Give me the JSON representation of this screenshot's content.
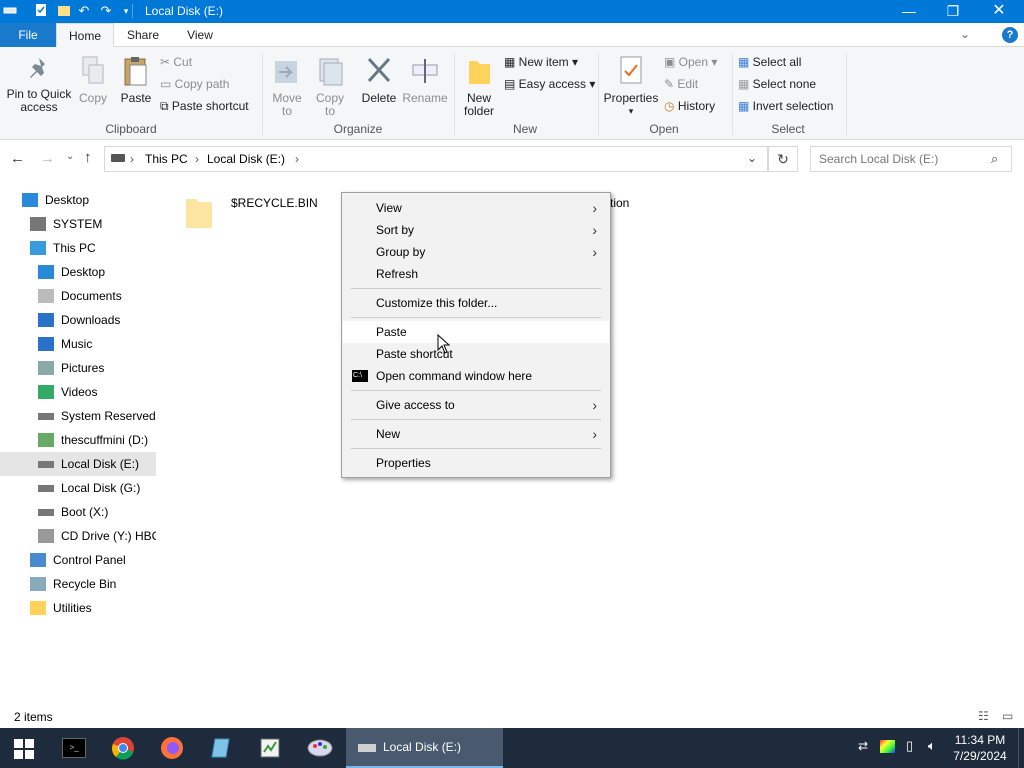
{
  "window": {
    "title": "Local Disk (E:)"
  },
  "ribbon_tabs": {
    "file": "File",
    "home": "Home",
    "share": "Share",
    "view": "View"
  },
  "ribbon": {
    "clipboard": {
      "pin": "Pin to Quick access",
      "copy": "Copy",
      "paste": "Paste",
      "cut": "Cut",
      "copy_path": "Copy path",
      "paste_shortcut": "Paste shortcut",
      "group": "Clipboard"
    },
    "organize": {
      "move_to": "Move to",
      "copy_to": "Copy to",
      "delete": "Delete",
      "rename": "Rename",
      "group": "Organize"
    },
    "new": {
      "new_folder": "New folder",
      "new_item": "New item",
      "easy_access": "Easy access",
      "group": "New"
    },
    "open": {
      "properties": "Properties",
      "open": "Open",
      "edit": "Edit",
      "history": "History",
      "group": "Open"
    },
    "select": {
      "select_all": "Select all",
      "select_none": "Select none",
      "invert": "Invert selection",
      "group": "Select"
    }
  },
  "address": {
    "crumbs": [
      "This PC",
      "Local Disk (E:)"
    ],
    "search_placeholder": "Search Local Disk (E:)"
  },
  "nav": {
    "items": [
      {
        "label": "Desktop",
        "icon": "desktop-icon"
      },
      {
        "label": "SYSTEM",
        "icon": "user-icon"
      },
      {
        "label": "This PC",
        "icon": "computer-icon"
      },
      {
        "label": "Desktop",
        "icon": "desktop-icon"
      },
      {
        "label": "Documents",
        "icon": "documents-icon"
      },
      {
        "label": "Downloads",
        "icon": "downloads-icon"
      },
      {
        "label": "Music",
        "icon": "music-icon"
      },
      {
        "label": "Pictures",
        "icon": "pictures-icon"
      },
      {
        "label": "Videos",
        "icon": "videos-icon"
      },
      {
        "label": "System Reserved (",
        "icon": "drive-icon"
      },
      {
        "label": "thescuffmini (D:)",
        "icon": "usb-drive-icon"
      },
      {
        "label": "Local Disk (E:)",
        "icon": "drive-icon"
      },
      {
        "label": "Local Disk (G:)",
        "icon": "drive-icon"
      },
      {
        "label": "Boot (X:)",
        "icon": "drive-icon"
      },
      {
        "label": "CD Drive (Y:) HBC",
        "icon": "cd-drive-icon"
      },
      {
        "label": "Control Panel",
        "icon": "control-panel-icon"
      },
      {
        "label": "Recycle Bin",
        "icon": "recycle-bin-icon"
      },
      {
        "label": "Utilities",
        "icon": "folder-icon"
      }
    ]
  },
  "content": {
    "items": [
      {
        "name": "$RECYCLE.BIN"
      },
      {
        "name": "tion"
      }
    ]
  },
  "context_menu": {
    "view": "View",
    "sort_by": "Sort by",
    "group_by": "Group by",
    "refresh": "Refresh",
    "customize": "Customize this folder...",
    "paste": "Paste",
    "paste_shortcut": "Paste shortcut",
    "open_cmd": "Open command window here",
    "give_access": "Give access to",
    "new": "New",
    "properties": "Properties"
  },
  "status": {
    "count": "2 items"
  },
  "taskbar": {
    "active_window": "Local Disk (E:)",
    "time": "11:34 PM",
    "date": "7/29/2024"
  },
  "colors": {
    "accent": "#0078d7",
    "taskbar": "#1e2b3c",
    "selection": "#e5e5e5"
  }
}
